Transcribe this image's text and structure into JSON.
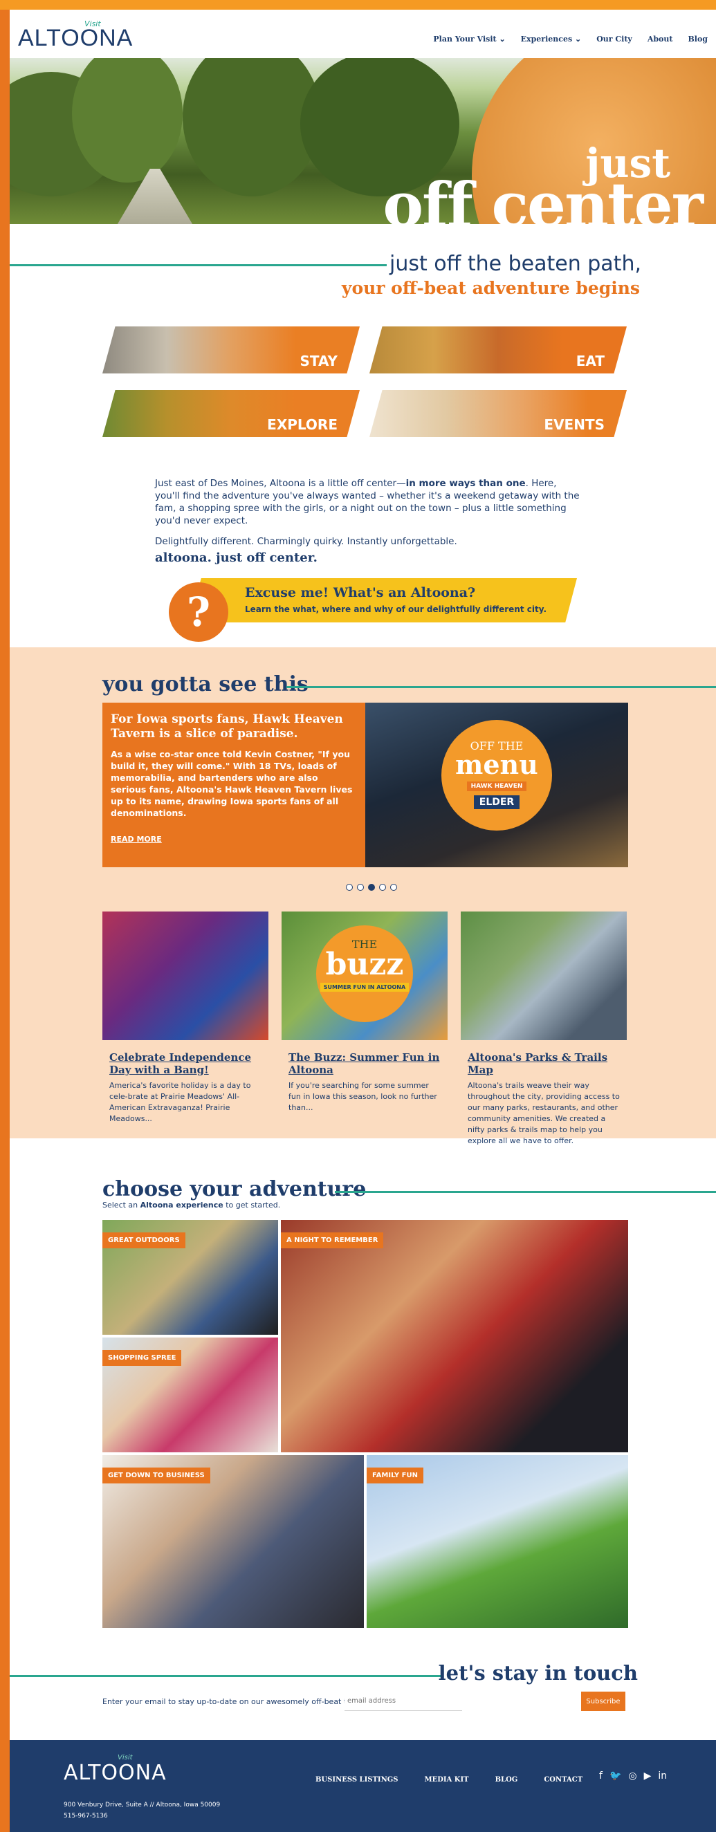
{
  "header": {
    "logo_visit": "Visit",
    "logo_word": "ALTOONA",
    "nav": [
      "Plan Your Visit ⌄",
      "Experiences ⌄",
      "Our City",
      "About",
      "Blog"
    ]
  },
  "hero": {
    "line1": "just",
    "line2": "off center"
  },
  "tagline": {
    "line1": "just off the beaten path,",
    "line2": "your off-beat adventure begins"
  },
  "tiles": [
    "STAY",
    "EAT",
    "EXPLORE",
    "EVENTS"
  ],
  "intro": {
    "p1_a": "Just east of Des Moines, Altoona is a little off center—",
    "p1_b": "in more ways than one",
    "p1_c": ". Here, you'll find the adventure you've always wanted – whether it's a weekend getaway with the fam, a shopping spree with the girls, or a night out on the town – plus a little something you'd never expect.",
    "p2": "Delightfully different. Charmingly quirky. Instantly unforgettable.",
    "signature": "altoona. just off center."
  },
  "excuse": {
    "title": "Excuse me! What's an Altoona?",
    "sub": "Learn the what, where and why of our delightfully different city.",
    "icon": "?"
  },
  "see_this": {
    "title": "you gotta see this",
    "feature": {
      "headline": "For Iowa sports fans, Hawk Heaven Tavern is a slice of paradise.",
      "body": "As a wise co-star once told Kevin Costner, \"If you build it, they will come.\" With 18 TVs, loads of memorabilia, and bartenders who are also serious fans, Altoona's Hawk Heaven Tavern lives up to its name, drawing Iowa sports fans of all denominations.",
      "more": "READ MORE",
      "badge_a": "OFF THE",
      "badge_b": "menu",
      "badge_c": "HAWK HEAVEN",
      "badge_d": "ELDER"
    },
    "cards": [
      {
        "title": "Celebrate Independence Day with a Bang!",
        "text": "America's favorite holiday is a day to cele-brate at Prairie Meadows' All-American Extravaganza! Prairie Meadows..."
      },
      {
        "title": "The Buzz: Summer Fun in Altoona",
        "text": "If you're searching for some summer fun in Iowa this season, look no further than...",
        "badge_a": "THE",
        "badge_b": "buzz",
        "badge_c": "SUMMER FUN IN ALTOONA"
      },
      {
        "title": "Altoona's Parks & Trails Map",
        "text": "Altoona's trails weave their way throughout the city, providing access to our many parks, restaurants, and other community amenities. We created a nifty parks & trails map to help you explore all we have to offer."
      }
    ]
  },
  "adventure": {
    "title": "choose your adventure",
    "sub_a": "Select an ",
    "sub_b": "Altoona experience",
    "sub_c": " to get started.",
    "badges": [
      "GREAT OUTDOORS",
      "A NIGHT TO REMEMBER",
      "SHOPPING SPREE",
      "GET DOWN TO BUSINESS",
      "FAMILY FUN"
    ]
  },
  "touch": {
    "title": "let's stay in touch",
    "text": "Enter your email to stay up-to-date on our awesomely off-beat town.",
    "placeholder": "email address",
    "button": "Subscribe"
  },
  "footer": {
    "logo_visit": "Visit",
    "logo_word": "ALTOONA",
    "links": [
      "BUSINESS LISTINGS",
      "MEDIA KIT",
      "BLOG",
      "CONTACT"
    ],
    "social": [
      "f",
      "🐦",
      "◎",
      "▶",
      "in"
    ],
    "address": "900 Venbury Drive, Suite A // Altoona, Iowa 50009",
    "phone": "515-967-5136"
  },
  "colors": {
    "orange": "#e8751f",
    "navy": "#1f3d6b",
    "teal": "#2aa68f",
    "peach": "#fbdcc0",
    "yellow": "#f6c21c"
  }
}
